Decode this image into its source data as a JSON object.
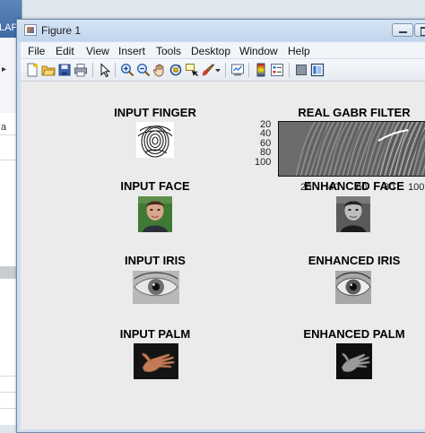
{
  "background_app": {
    "title": "LAPP",
    "panel_label": "a"
  },
  "figure": {
    "title": "Figure 1",
    "menu": [
      "File",
      "Edit",
      "View",
      "Insert",
      "Tools",
      "Desktop",
      "Window",
      "Help"
    ],
    "toolbar_icons": [
      "new-figure-icon",
      "open-file-icon",
      "save-figure-icon",
      "print-figure-icon",
      "edit-plot-arrow-icon",
      "zoom-in-icon",
      "zoom-out-icon",
      "pan-hand-icon",
      "rotate-3d-icon",
      "data-cursor-icon",
      "brush-icon",
      "brush-dropdown-icon",
      "link-plot-icon",
      "insert-colorbar-icon",
      "insert-legend-icon",
      "hide-plot-tools-icon",
      "show-plot-tools-icon"
    ]
  },
  "panels": {
    "input_finger": {
      "title": "INPUT FINGER"
    },
    "gabor_filter": {
      "title": "REAL GABR FILTER",
      "y_ticks": [
        "20",
        "40",
        "60",
        "80",
        "100"
      ],
      "x_ticks": [
        "20",
        "40",
        "60",
        "80",
        "100"
      ]
    },
    "input_face": {
      "title": "INPUT FACE"
    },
    "enhanced_face": {
      "title": "ENHANCED FACE"
    },
    "input_iris": {
      "title": "INPUT IRIS"
    },
    "enhanced_iris": {
      "title": "ENHANCED IRIS"
    },
    "input_palm": {
      "title": "INPUT PALM"
    },
    "enhanced_palm": {
      "title": "ENHANCED PALM"
    }
  }
}
